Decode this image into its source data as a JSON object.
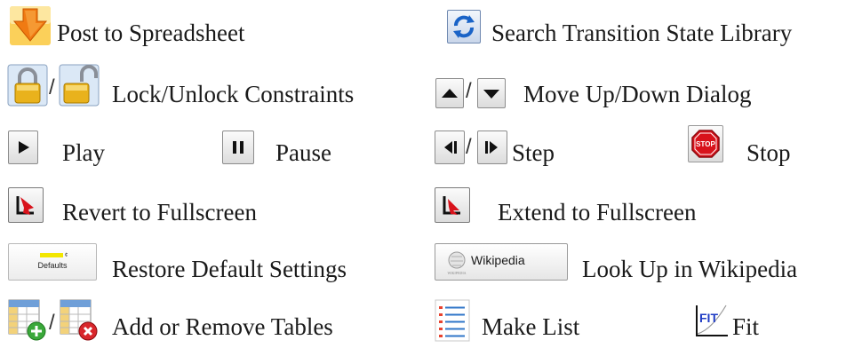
{
  "legend": {
    "post_to_spreadsheet": "Post to Spreadsheet",
    "search_ts_library": "Search Transition State Library",
    "lock_unlock": "Lock/Unlock Constraints",
    "move_up_down": "Move Up/Down Dialog",
    "play": "Play",
    "pause": "Pause",
    "step": "Step",
    "stop": "Stop",
    "revert_fullscreen": "Revert to Fullscreen",
    "extend_fullscreen": "Extend to Fullscreen",
    "restore_defaults": "Restore Default Settings",
    "look_up_wikipedia": "Look Up in Wikipedia",
    "add_remove_tables": "Add or Remove Tables",
    "make_list": "Make List",
    "fit": "Fit",
    "separator": "/"
  },
  "buttons": {
    "defaults_caption": "Defaults",
    "wikipedia_caption": "Wikipedia",
    "stop_sign_text": "STOP",
    "fit_icon_text": "FIT"
  },
  "colors": {
    "accent_blue": "#1a63c7",
    "stop_red": "#d8121b",
    "post_orange": "#f59a10",
    "lock_gold": "#e9b21c"
  },
  "icons": {
    "post": "download-arrow-icon",
    "search": "refresh-icon",
    "lock": "padlock-closed-icon",
    "unlock": "padlock-open-icon",
    "move_up": "triangle-up-icon",
    "move_down": "triangle-down-icon",
    "play": "play-icon",
    "pause": "pause-icon",
    "step_back": "step-back-icon",
    "step_forward": "step-forward-icon",
    "stop": "stop-sign-icon",
    "revert": "revert-fullscreen-icon",
    "extend": "extend-fullscreen-icon",
    "add_table": "table-add-icon",
    "remove_table": "table-remove-icon",
    "list": "list-icon",
    "fit": "fit-curve-icon"
  }
}
